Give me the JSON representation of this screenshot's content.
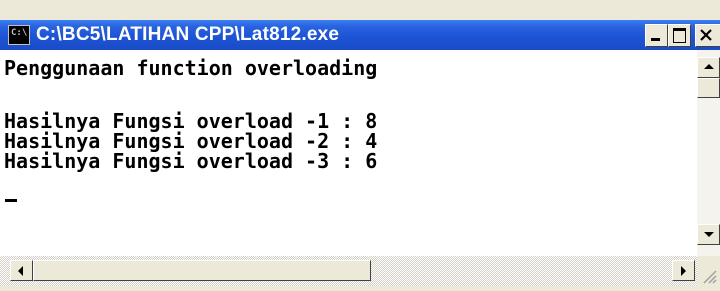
{
  "window": {
    "title": "C:\\BC5\\LATIHAN CPP\\Lat812.exe",
    "icon": "console-icon",
    "icon_text": "C:\\"
  },
  "console": {
    "lines": [
      "Penggunaan function overloading",
      "",
      "Hasilnya Fungsi overload -1 : 8",
      "Hasilnya Fungsi overload -2 : 4",
      "Hasilnya Fungsi overload -3 : 6"
    ]
  },
  "colors": {
    "titlebar": "#1d54d6",
    "console_bg": "#ffffff",
    "console_text": "#000000",
    "chrome": "#ece9d8"
  }
}
